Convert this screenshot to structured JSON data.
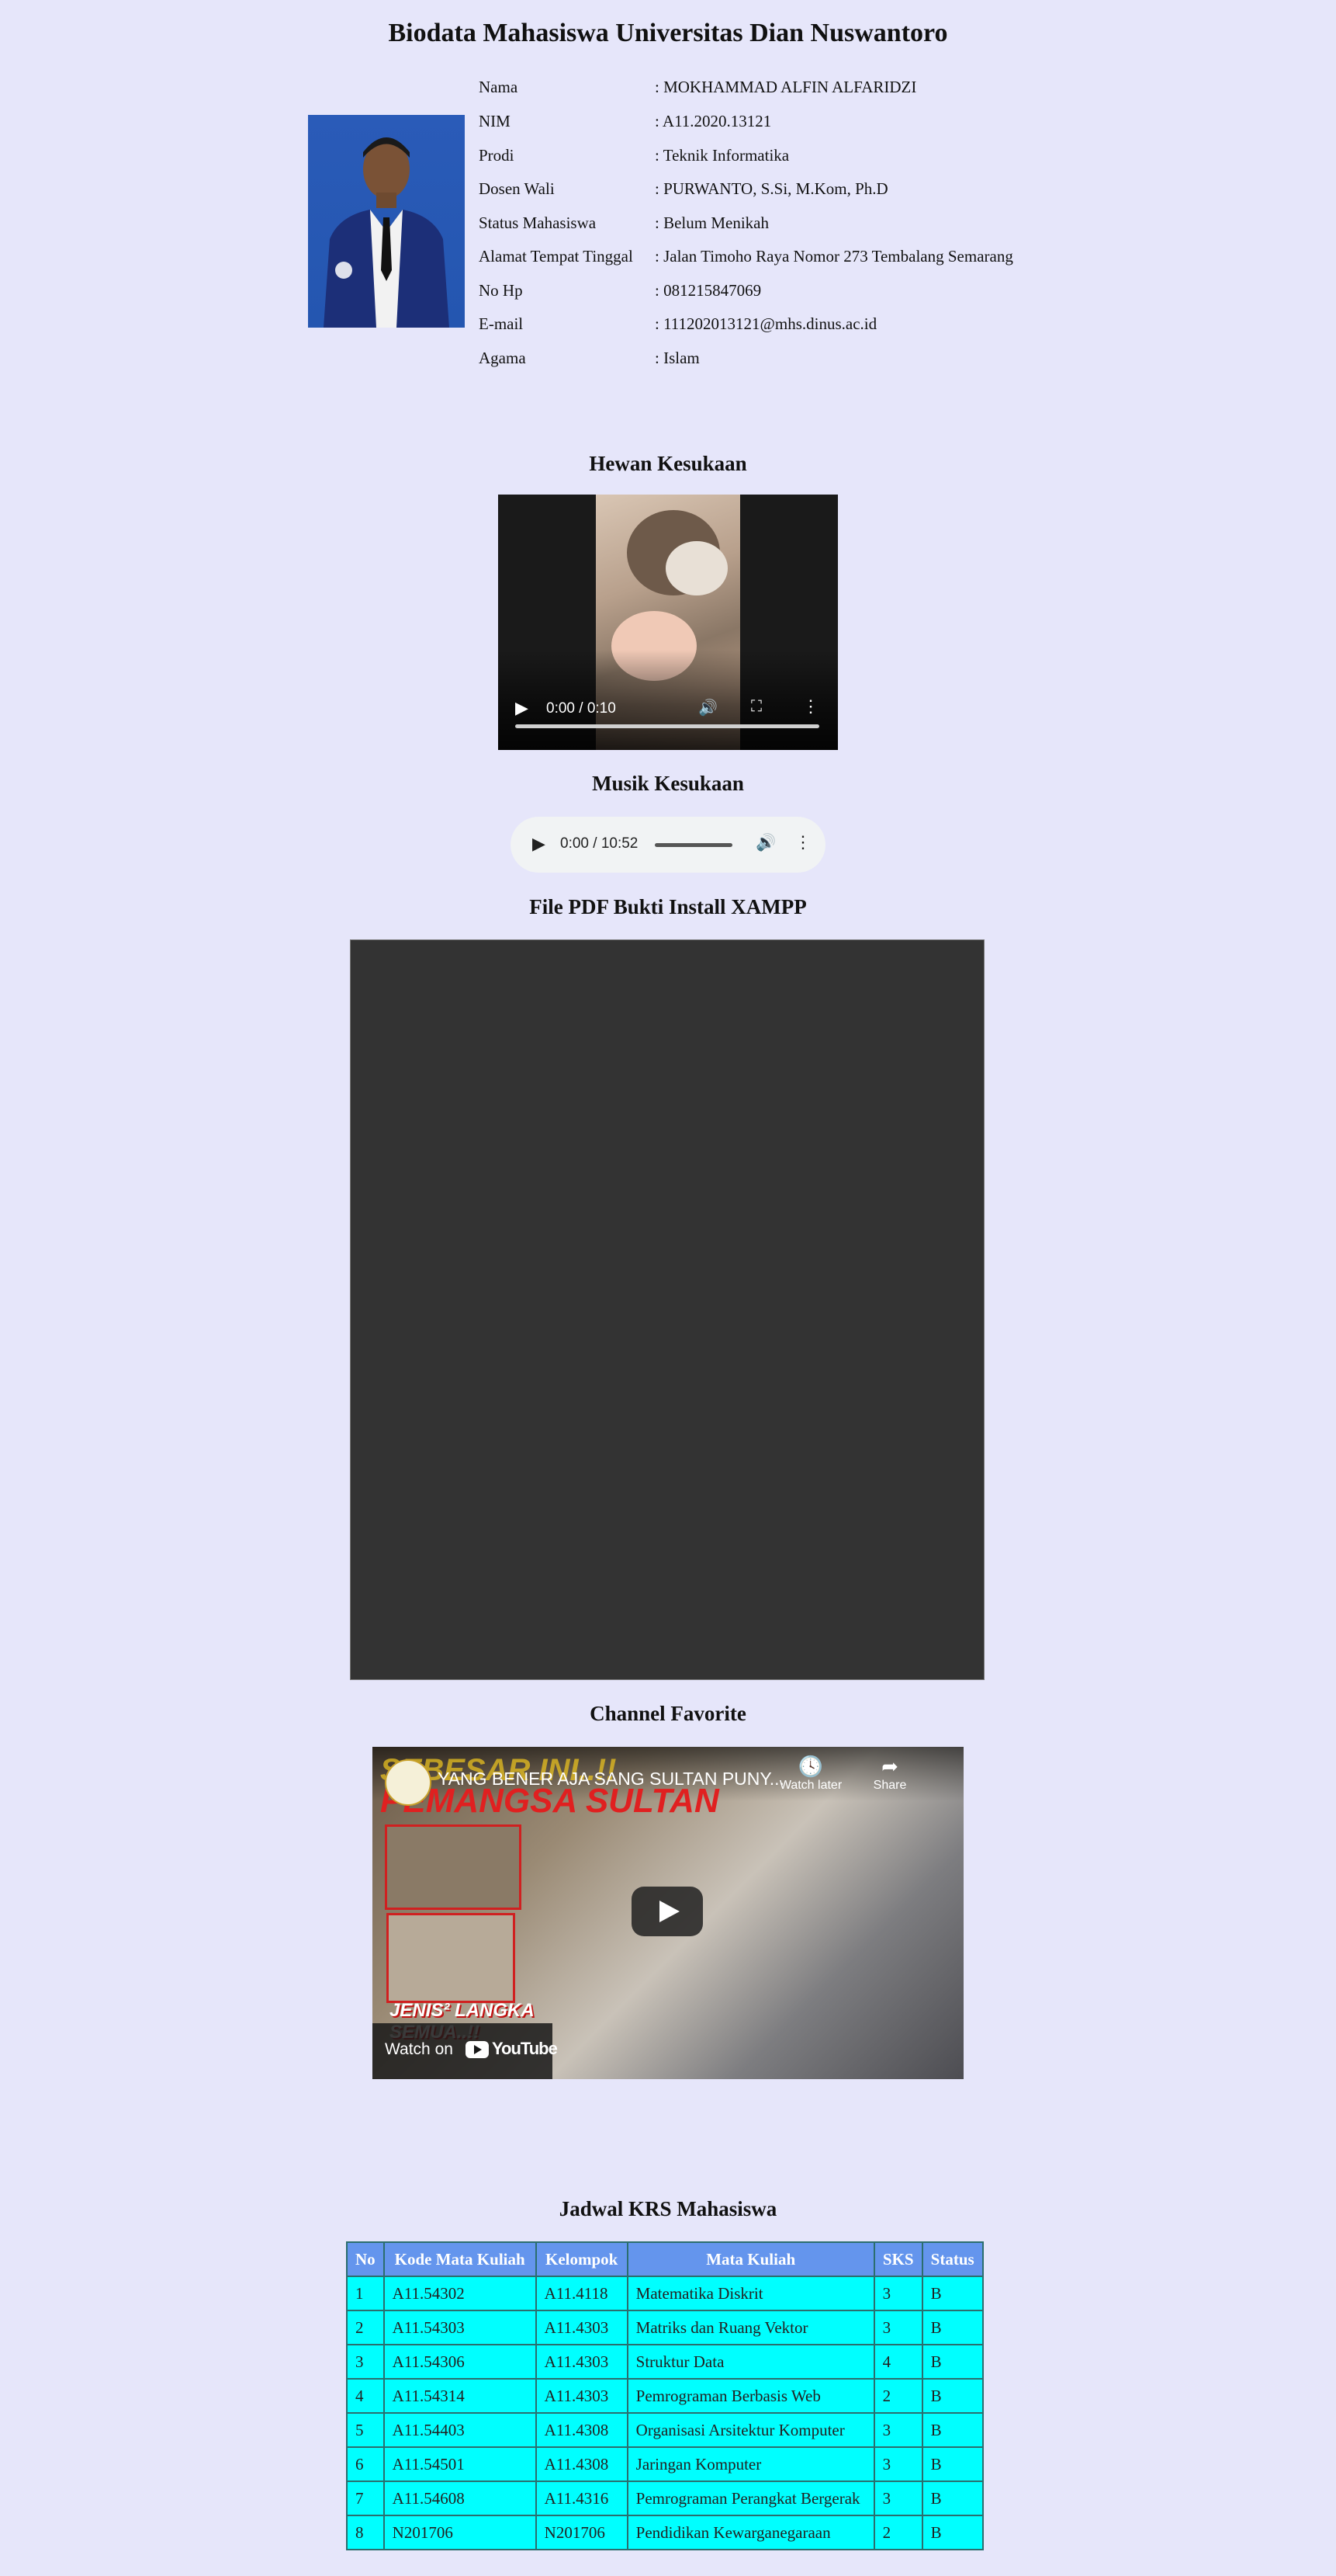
{
  "page_title": "Biodata Mahasiswa Universitas Dian Nuswantoro",
  "bio": [
    {
      "label": "Nama",
      "value": ": MOKHAMMAD ALFIN ALFARIDZI"
    },
    {
      "label": "NIM",
      "value": ": A11.2020.13121"
    },
    {
      "label": "Prodi",
      "value": ": Teknik Informatika"
    },
    {
      "label": "Dosen Wali",
      "value": ": PURWANTO, S.Si, M.Kom, Ph.D"
    },
    {
      "label": "Status Mahasiswa",
      "value": ": Belum Menikah"
    },
    {
      "label": "Alamat Tempat Tinggal",
      "value": ": Jalan Timoho Raya Nomor 273 Tembalang Semarang"
    },
    {
      "label": "No Hp",
      "value": ": 081215847069"
    },
    {
      "label": "E-mail",
      "value": ": 111202013121@mhs.dinus.ac.id"
    },
    {
      "label": "Agama",
      "value": ": Islam"
    }
  ],
  "sections": {
    "pet": "Hewan Kesukaan",
    "music": "Musik Kesukaan",
    "pdf": "File PDF Bukti Install XAMPP",
    "channel": "Channel Favorite",
    "krs": "Jadwal KRS Mahasiswa"
  },
  "video": {
    "time": "0:00 / 0:10"
  },
  "audio": {
    "time": "0:00 / 10:52"
  },
  "youtube": {
    "title": "YANG BENER AJA SANG SULTAN PUNY...",
    "watch_later": "Watch later",
    "share": "Share",
    "watch_on": "Watch on",
    "youtube_logo": "YouTube",
    "thumb_text_top": "SEBESAR INI..!!",
    "thumb_text_main": "PEMANGSA SULTAN",
    "thumb_text_bottom": "JENIS² LANGKA SEMUA..!!"
  },
  "krs_table": {
    "headers": [
      "No",
      "Kode Mata Kuliah",
      "Kelompok",
      "Mata Kuliah",
      "SKS",
      "Status"
    ],
    "rows": [
      [
        "1",
        "A11.54302",
        "A11.4118",
        "Matematika Diskrit",
        "3",
        "B"
      ],
      [
        "2",
        "A11.54303",
        "A11.4303",
        "Matriks dan Ruang Vektor",
        "3",
        "B"
      ],
      [
        "3",
        "A11.54306",
        "A11.4303",
        "Struktur Data",
        "4",
        "B"
      ],
      [
        "4",
        "A11.54314",
        "A11.4303",
        "Pemrograman Berbasis Web",
        "2",
        "B"
      ],
      [
        "5",
        "A11.54403",
        "A11.4308",
        "Organisasi Arsitektur Komputer",
        "3",
        "B"
      ],
      [
        "6",
        "A11.54501",
        "A11.4308",
        "Jaringan Komputer",
        "3",
        "B"
      ],
      [
        "7",
        "A11.54608",
        "A11.4316",
        "Pemrograman Perangkat Bergerak",
        "3",
        "B"
      ],
      [
        "8",
        "N201706",
        "N201706",
        "Pendidikan Kewarganegaraan",
        "2",
        "B"
      ]
    ]
  },
  "colors": {
    "background": "#e6e6fa",
    "table_header": "#6495ed",
    "table_cell": "#00ffff"
  }
}
